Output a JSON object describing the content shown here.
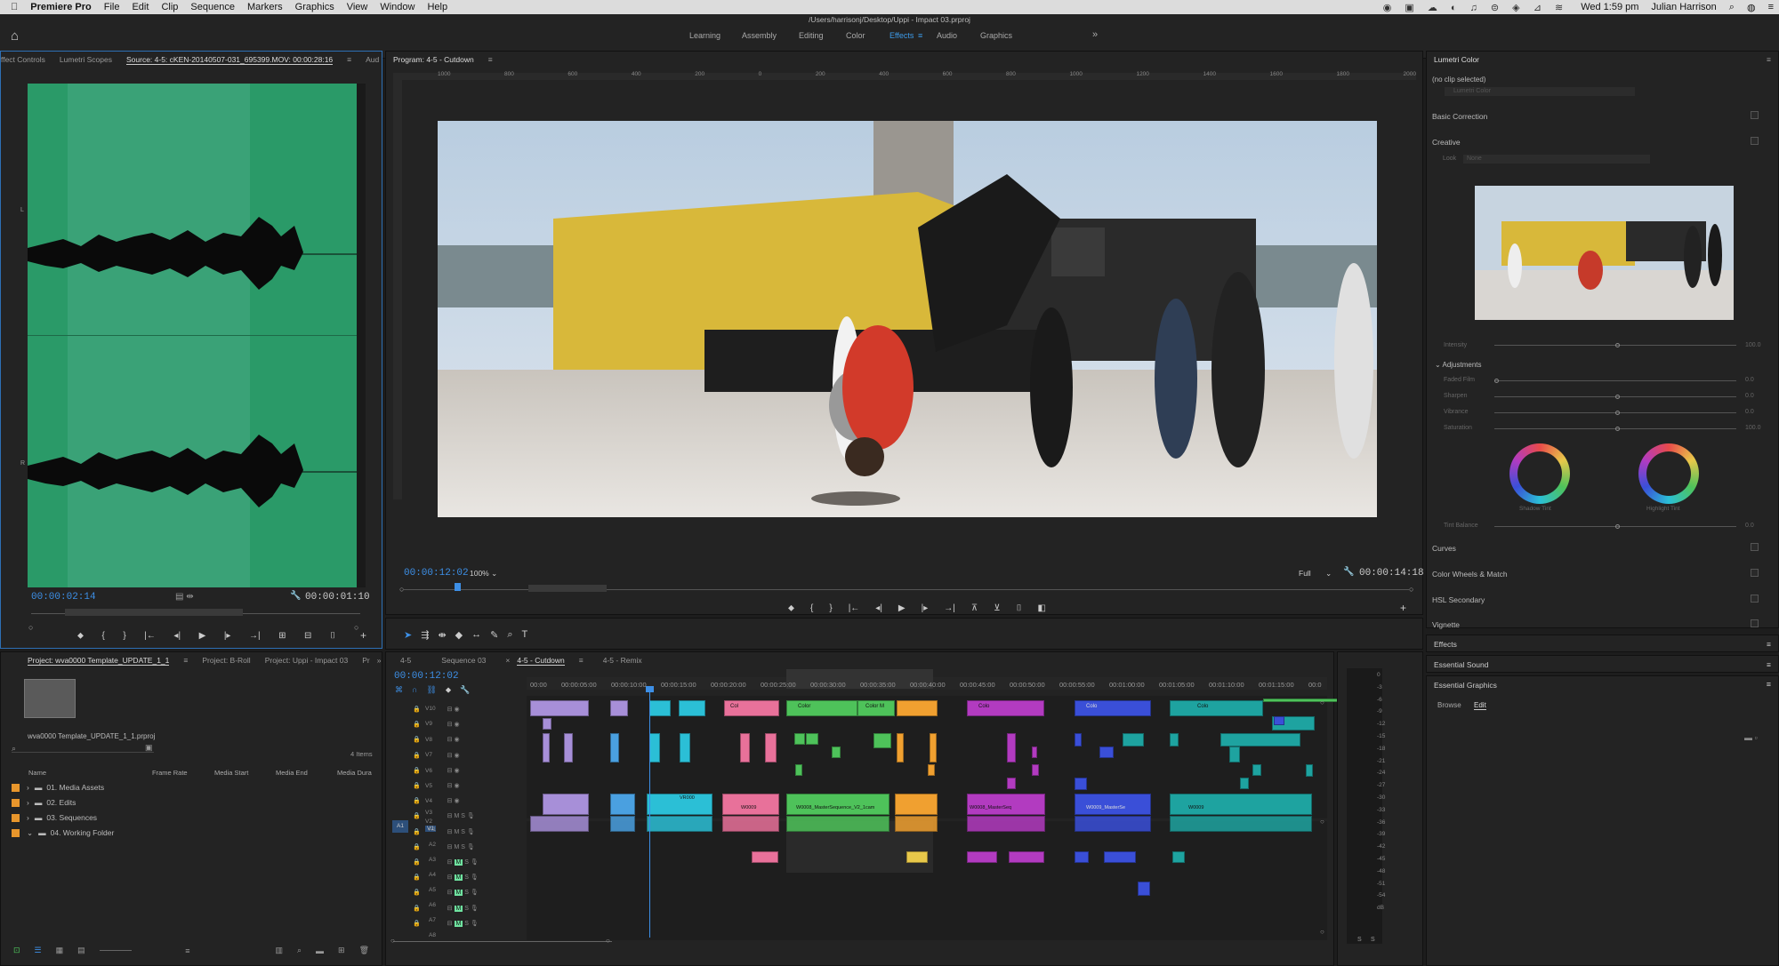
{
  "menubar": {
    "apple": "",
    "app_name": "Premiere Pro",
    "items": [
      "File",
      "Edit",
      "Clip",
      "Sequence",
      "Markers",
      "Graphics",
      "View",
      "Window",
      "Help"
    ],
    "status": {
      "datetime": "Wed 1:59 pm",
      "user": "Julian Harrison"
    }
  },
  "window": {
    "path": "/Users/harrisonj/Desktop/Uppi - Impact 03.prproj"
  },
  "workspaces": {
    "tabs": [
      "Learning",
      "Assembly",
      "Editing",
      "Color",
      "Effects",
      "Audio",
      "Graphics"
    ],
    "active": "Effects",
    "more": "»"
  },
  "source_panel": {
    "tabs": [
      "ffect Controls",
      "Lumetri Scopes",
      "Source: 4-5: cKEN-20140507-031_695399.MOV: 00:00:28:16",
      "Aud"
    ],
    "current_timecode": "00:00:02:14",
    "duration_timecode": "00:00:01:10",
    "channel_labels": [
      "L",
      "R"
    ]
  },
  "program_panel": {
    "title": "Program: 4-5 - Cutdown",
    "current_timecode": "00:00:12:02",
    "zoom": "100%",
    "quality": "Full",
    "duration_timecode": "00:00:14:18",
    "ruler_ticks": [
      "1000",
      "800",
      "600",
      "400",
      "200",
      "0",
      "200",
      "400",
      "600",
      "800",
      "1000",
      "1200",
      "1400",
      "1600",
      "1800",
      "2000"
    ]
  },
  "lumetri": {
    "title": "Lumetri Color",
    "no_clip": "(no clip selected)",
    "clip_dropdown": "Lumetri Color",
    "basic_correction": "Basic Correction",
    "creative": "Creative",
    "look_label": "Look",
    "look_value": "None",
    "intensity_label": "Intensity",
    "intensity_value": "100.0",
    "adjustments": "Adjustments",
    "adjust_rows": [
      {
        "label": "Faded Film",
        "value": "0.0"
      },
      {
        "label": "Sharpen",
        "value": "0.0"
      },
      {
        "label": "Vibrance",
        "value": "0.0"
      },
      {
        "label": "Saturation",
        "value": "100.0"
      }
    ],
    "shadow_tint": "Shadow Tint",
    "highlight_tint": "Highlight Tint",
    "tint_balance_label": "Tint Balance",
    "tint_balance_value": "0.0",
    "sections": [
      "Curves",
      "Color Wheels & Match",
      "HSL Secondary",
      "Vignette"
    ]
  },
  "right_lower": {
    "effects": "Effects",
    "essential_sound": "Essential Sound",
    "essential_graphics": "Essential Graphics",
    "browse": "Browse",
    "edit": "Edit"
  },
  "project_panel": {
    "tabs": [
      "Project: wva0000 Template_UPDATE_1_1",
      "Project: B-Roll",
      "Project: Uppi - Impact 03",
      "Pr"
    ],
    "file_name": "wva0000 Template_UPDATE_1_1.prproj",
    "item_count": "4 Items",
    "columns": [
      "Name",
      "Frame Rate",
      "Media Start",
      "Media End",
      "Media Dura"
    ],
    "folders": [
      "01. Media Assets",
      "02. Edits",
      "03. Sequences",
      "04. Working Folder"
    ]
  },
  "timeline": {
    "tabs": [
      "4-5",
      "Sequence 03",
      "4-5 - Cutdown",
      "4-5 - Remix"
    ],
    "active_tab": "4-5 - Cutdown",
    "current_timecode": "00:00:12:02",
    "ruler": [
      "00:00",
      "00:00:05:00",
      "00:00:10:00",
      "00:00:15:00",
      "00:00:20:00",
      "00:00:25:00",
      "00:00:30:00",
      "00:00:35:00",
      "00:00:40:00",
      "00:00:45:00",
      "00:00:50:00",
      "00:00:55:00",
      "00:01:00:00",
      "00:01:05:00",
      "00:01:10:00",
      "00:01:15:00",
      "00:0"
    ],
    "video_tracks": [
      "V10",
      "V9",
      "V8",
      "V7",
      "V6",
      "V5",
      "V4",
      "V3",
      "V2",
      "V1"
    ],
    "audio_tracks": [
      "A1",
      "A2",
      "A3",
      "A4",
      "A5",
      "A6",
      "A7",
      "A8"
    ],
    "source_patch": "A1",
    "clip_labels": [
      "Col",
      "Color",
      "Col",
      "Color M",
      "Colo",
      "Color",
      "Colo",
      "Colo",
      "Color",
      "VR000",
      "W0009",
      "W0008_MasterSequence_V2_1cam",
      "W0008_MasterSeq",
      "W0009_MasterSe",
      "W0009"
    ],
    "colors": {
      "lavender": "#a78fd8",
      "blue": "#4aa0e0",
      "cyan": "#2bbfd6",
      "pink": "#e8719a",
      "green": "#4ec25a",
      "orange": "#f0a030",
      "magenta": "#b23bc0",
      "royal": "#3a4fd8",
      "teal": "#1ea3a0",
      "mint": "#6fe3a0",
      "yellow": "#e8c84a"
    }
  },
  "audio_meter": {
    "scale": [
      "0",
      "-3",
      "-6",
      "-9",
      "-12",
      "-15",
      "-18",
      "-21",
      "-24",
      "-27",
      "-30",
      "-33",
      "-36",
      "-39",
      "-42",
      "-45",
      "-48",
      "-51",
      "-54",
      "dB"
    ],
    "solo": [
      "S",
      "S"
    ]
  },
  "tools": [
    "selection-tool",
    "track-select-tool",
    "ripple-edit-tool",
    "razor-tool",
    "slip-tool",
    "pen-tool",
    "hand-tool",
    "type-tool"
  ]
}
